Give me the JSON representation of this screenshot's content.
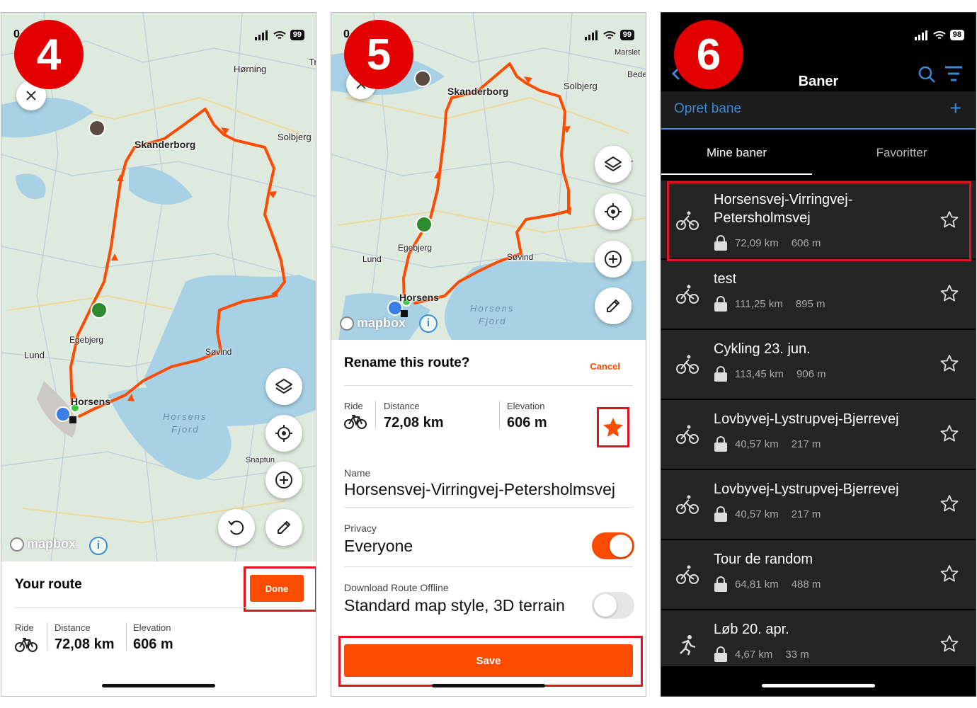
{
  "panel4": {
    "badge": "4",
    "status_time": "0",
    "battery": "99",
    "map_labels": {
      "horning": "Hørning",
      "tr": "Tr",
      "skanderborg": "Skanderborg",
      "solbjerg": "Solbjerg",
      "egebjerg": "Egebjerg",
      "lund": "Lund",
      "sovind": "Søvind",
      "horsens": "Horsens",
      "horsens_fjord_1": "Horsens",
      "horsens_fjord_2": "Fjord",
      "snaptun": "Snaptun"
    },
    "mapbox_label": "mapbox",
    "info_label": "i",
    "sheet_title": "Your route",
    "done_label": "Done",
    "stats": {
      "ride_label": "Ride",
      "distance_label": "Distance",
      "distance_value": "72,08 km",
      "elevation_label": "Elevation",
      "elevation_value": "606 m"
    }
  },
  "panel5": {
    "badge": "5",
    "status_time": "0",
    "battery": "99",
    "map_labels": {
      "marslet": "Marslet",
      "bede": "Bede",
      "skanderborg": "Skanderborg",
      "solbjerg": "Solbjerg",
      "r": "r",
      "egebjerg": "Egebjerg",
      "lund": "Lund",
      "sovind": "Søvind",
      "horsens": "Horsens",
      "horsens_fjord_1": "Horsens",
      "horsens_fjord_2": "Fjord"
    },
    "mapbox_label": "mapbox",
    "info_label": "i",
    "rename_title": "Rename this route?",
    "cancel_label": "Cancel",
    "stats": {
      "ride_label": "Ride",
      "distance_label": "Distance",
      "distance_value": "72,08 km",
      "elevation_label": "Elevation",
      "elevation_value": "606 m"
    },
    "name_label": "Name",
    "name_value": "Horsensvej-Virringvej-Petersholmsvej",
    "privacy_label": "Privacy",
    "privacy_value": "Everyone",
    "privacy_toggle_on": true,
    "offline_label": "Download Route Offline",
    "offline_value": "Standard map style, 3D terrain",
    "offline_toggle_on": false,
    "save_label": "Save",
    "accent_color": "#fc4c02"
  },
  "panel6": {
    "badge": "6",
    "battery": "98",
    "title": "Baner",
    "create_label": "Opret bane",
    "create_plus": "+",
    "tabs": [
      {
        "label": "Mine baner",
        "active": true
      },
      {
        "label": "Favoritter",
        "active": false
      }
    ],
    "accent_color": "#3a88d8",
    "routes": [
      {
        "title": "Horsensvej-Virringvej-Petersholmsvej",
        "distance": "72,09 km",
        "elevation": "606 m",
        "type": "ride-icon",
        "highlighted": true
      },
      {
        "title": "test",
        "distance": "111,25 km",
        "elevation": "895 m",
        "type": "ride-icon",
        "highlighted": false
      },
      {
        "title": "Cykling 23. jun.",
        "distance": "113,45 km",
        "elevation": "906 m",
        "type": "ride-icon",
        "highlighted": false
      },
      {
        "title": "Lovbyvej-Lystrupvej-Bjerrevej",
        "distance": "40,57 km",
        "elevation": "217 m",
        "type": "ride-icon",
        "highlighted": false
      },
      {
        "title": "Lovbyvej-Lystrupvej-Bjerrevej",
        "distance": "40,57 km",
        "elevation": "217 m",
        "type": "ride-icon",
        "highlighted": false
      },
      {
        "title": "Tour de random",
        "distance": "64,81 km",
        "elevation": "488 m",
        "type": "ride-icon",
        "highlighted": false
      },
      {
        "title": "Løb 20. apr.",
        "distance": "4,67 km",
        "elevation": "33 m",
        "type": "run-icon",
        "highlighted": false
      }
    ]
  }
}
